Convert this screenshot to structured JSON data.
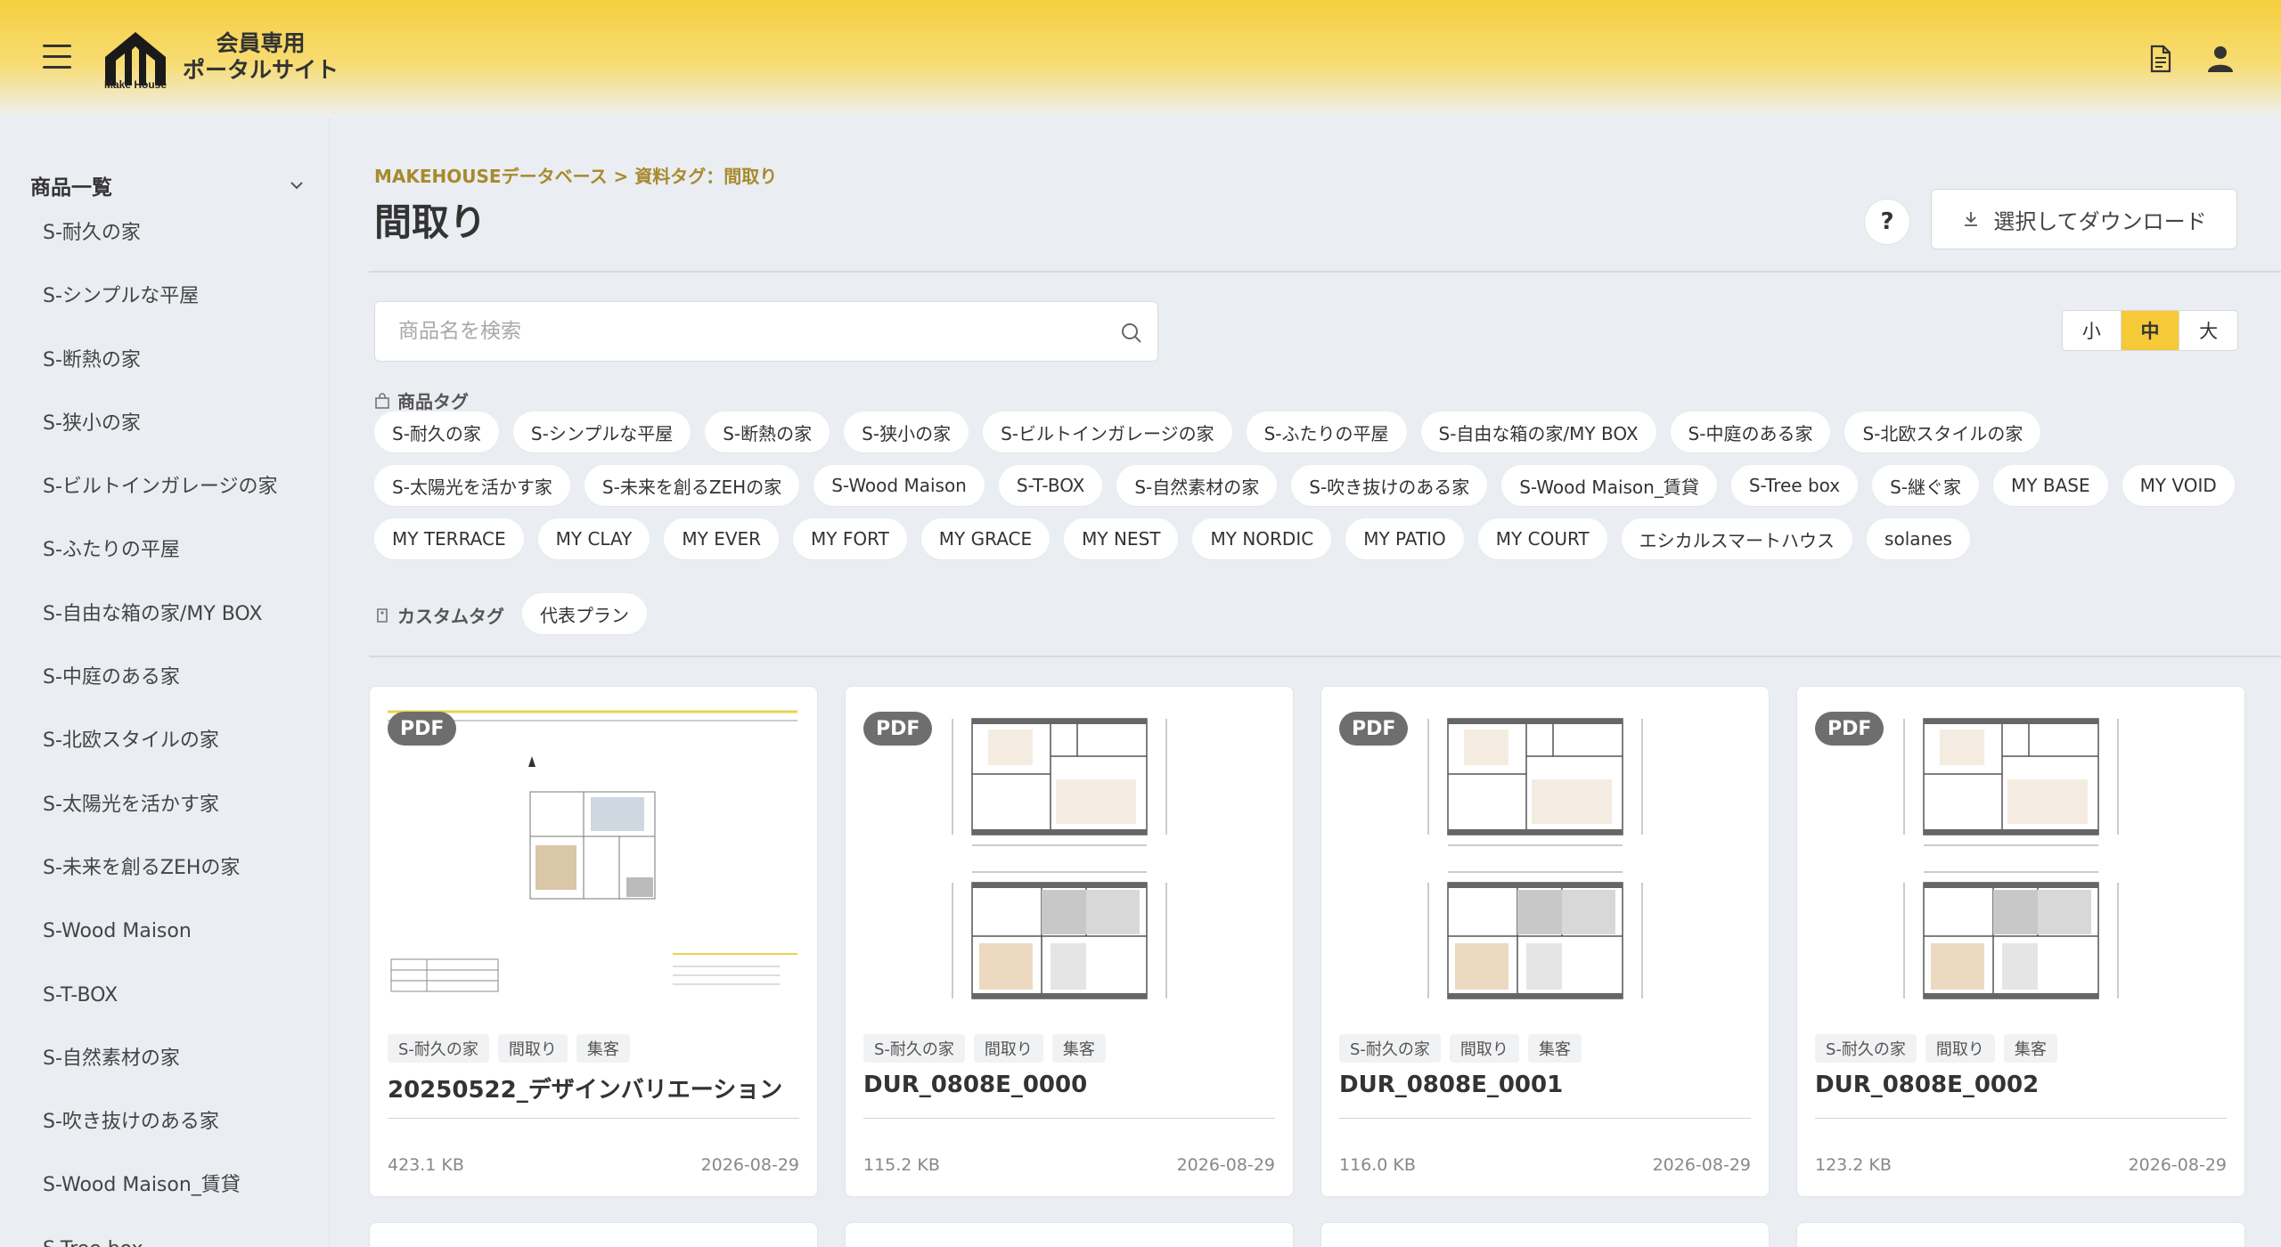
{
  "header": {
    "logo_text": "Make House",
    "portal_title_line1": "会員専用",
    "portal_title_line2": "ポータルサイト"
  },
  "sidebar": {
    "heading": "商品一覧",
    "items": [
      {
        "label": "S-耐久の家"
      },
      {
        "label": "S-シンプルな平屋"
      },
      {
        "label": "S-断熱の家"
      },
      {
        "label": "S-狭小の家"
      },
      {
        "label": "S-ビルトインガレージの家"
      },
      {
        "label": "S-ふたりの平屋"
      },
      {
        "label": "S-自由な箱の家/MY BOX"
      },
      {
        "label": "S-中庭のある家"
      },
      {
        "label": "S-北欧スタイルの家"
      },
      {
        "label": "S-太陽光を活かす家"
      },
      {
        "label": "S-未来を創るZEHの家"
      },
      {
        "label": "S-Wood Maison"
      },
      {
        "label": "S-T-BOX"
      },
      {
        "label": "S-自然素材の家"
      },
      {
        "label": "S-吹き抜けのある家"
      },
      {
        "label": "S-Wood Maison_賃貸"
      },
      {
        "label": "S-Tree box"
      }
    ]
  },
  "main": {
    "breadcrumb": "MAKEHOUSEデータベース > 資料タグ：間取り",
    "title": "間取り",
    "help_label": "?",
    "download_label": "選択してダウンロード",
    "search": {
      "placeholder": "商品名を検索",
      "value": ""
    },
    "size_options": [
      {
        "label": "小",
        "active": false
      },
      {
        "label": "中",
        "active": true
      },
      {
        "label": "大",
        "active": false
      }
    ],
    "product_tags_heading": "商品タグ",
    "product_tag_rows": [
      [
        "S-耐久の家",
        "S-シンプルな平屋",
        "S-断熱の家",
        "S-狭小の家",
        "S-ビルトインガレージの家",
        "S-ふたりの平屋",
        "S-自由な箱の家/MY BOX",
        "S-中庭のある家",
        "S-北欧スタイルの家"
      ],
      [
        "S-太陽光を活かす家",
        "S-未来を創るZEHの家",
        "S-Wood Maison",
        "S-T-BOX",
        "S-自然素材の家",
        "S-吹き抜けのある家",
        "S-Wood Maison_賃貸",
        "S-Tree box",
        "S-継ぐ家",
        "MY BASE",
        "MY VOID"
      ],
      [
        "MY TERRACE",
        "MY CLAY",
        "MY EVER",
        "MY FORT",
        "MY GRACE",
        "MY NEST",
        "MY NORDIC",
        "MY PATIO",
        "MY COURT",
        "エシカルスマートハウス",
        "solanes"
      ]
    ],
    "custom_tags_heading": "カスタムタグ",
    "custom_tags": [
      "代表プラン"
    ]
  },
  "cards": [
    {
      "badge": "PDF",
      "tags": [
        "S-耐久の家",
        "間取り",
        "集客"
      ],
      "title": "20250522_デザインバリエーション",
      "size": "423.1 KB",
      "date": "2026-08-29",
      "thumb": "sheet"
    },
    {
      "badge": "PDF",
      "tags": [
        "S-耐久の家",
        "間取り",
        "集客"
      ],
      "title": "DUR_0808E_0000",
      "size": "115.2 KB",
      "date": "2026-08-29",
      "thumb": "plan"
    },
    {
      "badge": "PDF",
      "tags": [
        "S-耐久の家",
        "間取り",
        "集客"
      ],
      "title": "DUR_0808E_0001",
      "size": "116.0 KB",
      "date": "2026-08-29",
      "thumb": "plan"
    },
    {
      "badge": "PDF",
      "tags": [
        "S-耐久の家",
        "間取り",
        "集客"
      ],
      "title": "DUR_0808E_0002",
      "size": "123.2 KB",
      "date": "2026-08-29",
      "thumb": "plan"
    }
  ],
  "colors": {
    "accent": "#f6c938",
    "breadcrumb": "#a78a2c",
    "badge": "#6e6e6e"
  }
}
